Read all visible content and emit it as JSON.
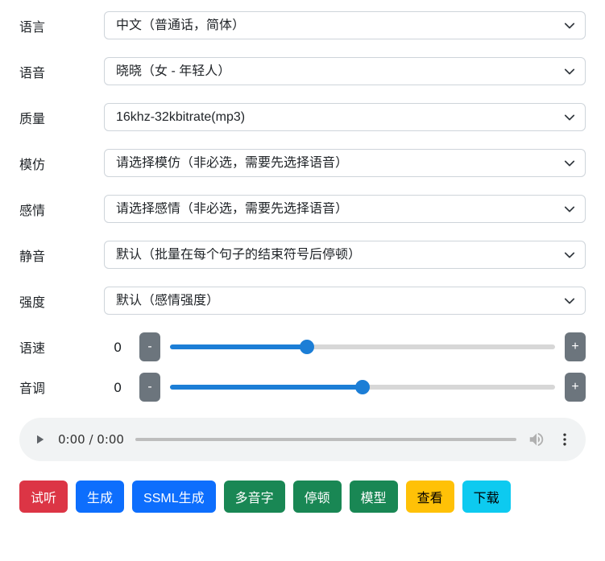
{
  "fields": {
    "language": {
      "label": "语言",
      "value": "中文（普通话，简体）"
    },
    "voice": {
      "label": "语音",
      "value": "晓晓（女 - 年轻人）"
    },
    "quality": {
      "label": "质量",
      "value": "16khz-32kbitrate(mp3)"
    },
    "imitation": {
      "label": "模仿",
      "value": "请选择模仿（非必选，需要先选择语音）"
    },
    "emotion": {
      "label": "感情",
      "value": "请选择感情（非必选，需要先选择语音）"
    },
    "mute": {
      "label": "静音",
      "value": "默认（批量在每个句子的结束符号后停顿）"
    },
    "intensity": {
      "label": "强度",
      "value": "默认（感情强度）"
    }
  },
  "sliders": {
    "speed": {
      "label": "语速",
      "value": "0",
      "pos": 35,
      "minus": "-",
      "plus": "+"
    },
    "pitch": {
      "label": "音调",
      "value": "0",
      "pos": 50,
      "minus": "-",
      "plus": "+"
    }
  },
  "audio": {
    "time": "0:00 / 0:00"
  },
  "buttons": {
    "preview": "试听",
    "generate": "生成",
    "ssml": "SSML生成",
    "poly": "多音字",
    "pause": "停顿",
    "model": "模型",
    "view": "查看",
    "download": "下载"
  }
}
